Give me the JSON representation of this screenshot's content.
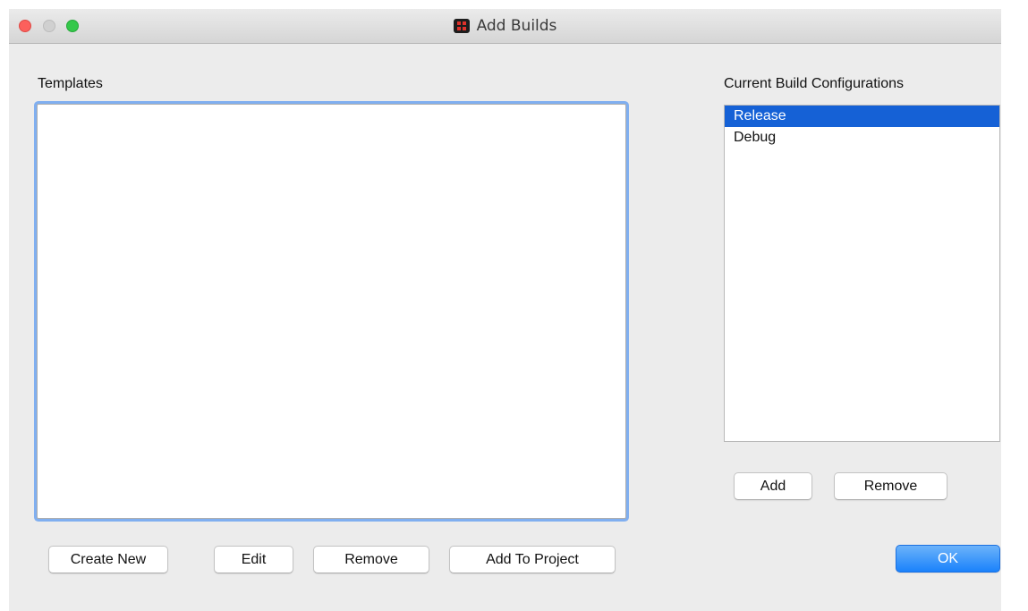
{
  "window": {
    "title": "Add Builds",
    "app_icon": "app-icon"
  },
  "templates": {
    "label": "Templates",
    "items": [],
    "buttons": {
      "create_new": "Create New",
      "edit": "Edit",
      "remove": "Remove",
      "add_to_project": "Add To Project"
    }
  },
  "configurations": {
    "label": "Current Build Configurations",
    "items": [
      "Release",
      "Debug"
    ],
    "selected": "Release",
    "buttons": {
      "add": "Add",
      "remove": "Remove"
    }
  },
  "footer": {
    "ok_label": "OK"
  },
  "colors": {
    "selection": "#1561d6",
    "focus_ring": "#80aff0",
    "primary_button": "#1a82fb"
  }
}
